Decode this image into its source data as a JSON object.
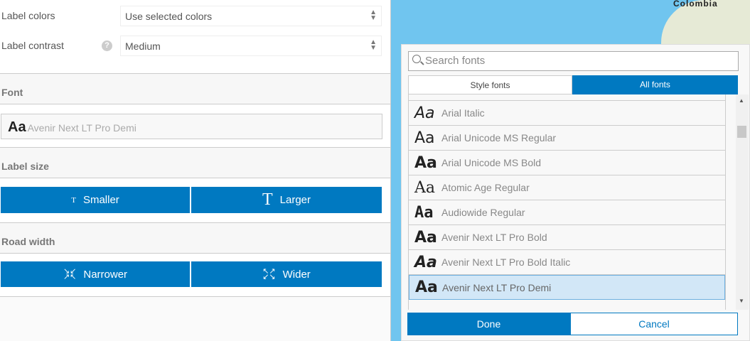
{
  "settings": {
    "label_colors": {
      "label": "Label colors",
      "value": "Use selected colors"
    },
    "label_contrast": {
      "label": "Label contrast",
      "value": "Medium",
      "help": "?"
    },
    "font": {
      "header": "Font",
      "preview": "Aa",
      "value": "Avenir Next LT Pro Demi"
    },
    "label_size": {
      "header": "Label size",
      "smaller": "Smaller",
      "larger": "Larger",
      "smaller_icon": "T",
      "larger_icon": "T"
    },
    "road_width": {
      "header": "Road width",
      "narrower": "Narrower",
      "wider": "Wider"
    }
  },
  "map": {
    "country_label": "Colombia"
  },
  "font_picker": {
    "search_placeholder": "Search fonts",
    "tabs": [
      {
        "label": "Style fonts",
        "active": false
      },
      {
        "label": "All fonts",
        "active": true
      }
    ],
    "fonts": [
      {
        "preview": "Aa",
        "name": "Arial Italic"
      },
      {
        "preview": "Aa",
        "name": "Arial Unicode MS Regular"
      },
      {
        "preview": "Aa",
        "name": "Arial Unicode MS Bold"
      },
      {
        "preview": "Aa",
        "name": "Atomic Age Regular"
      },
      {
        "preview": "Aa",
        "name": "Audiowide Regular"
      },
      {
        "preview": "Aa",
        "name": "Avenir Next LT Pro Bold"
      },
      {
        "preview": "Aa",
        "name": "Avenir Next LT Pro Bold Italic"
      },
      {
        "preview": "Aa",
        "name": "Avenir Next LT Pro Demi",
        "selected": true
      }
    ],
    "done": "Done",
    "cancel": "Cancel"
  },
  "colors": {
    "accent": "#0079c1",
    "selected_row": "#d2e7f7"
  }
}
